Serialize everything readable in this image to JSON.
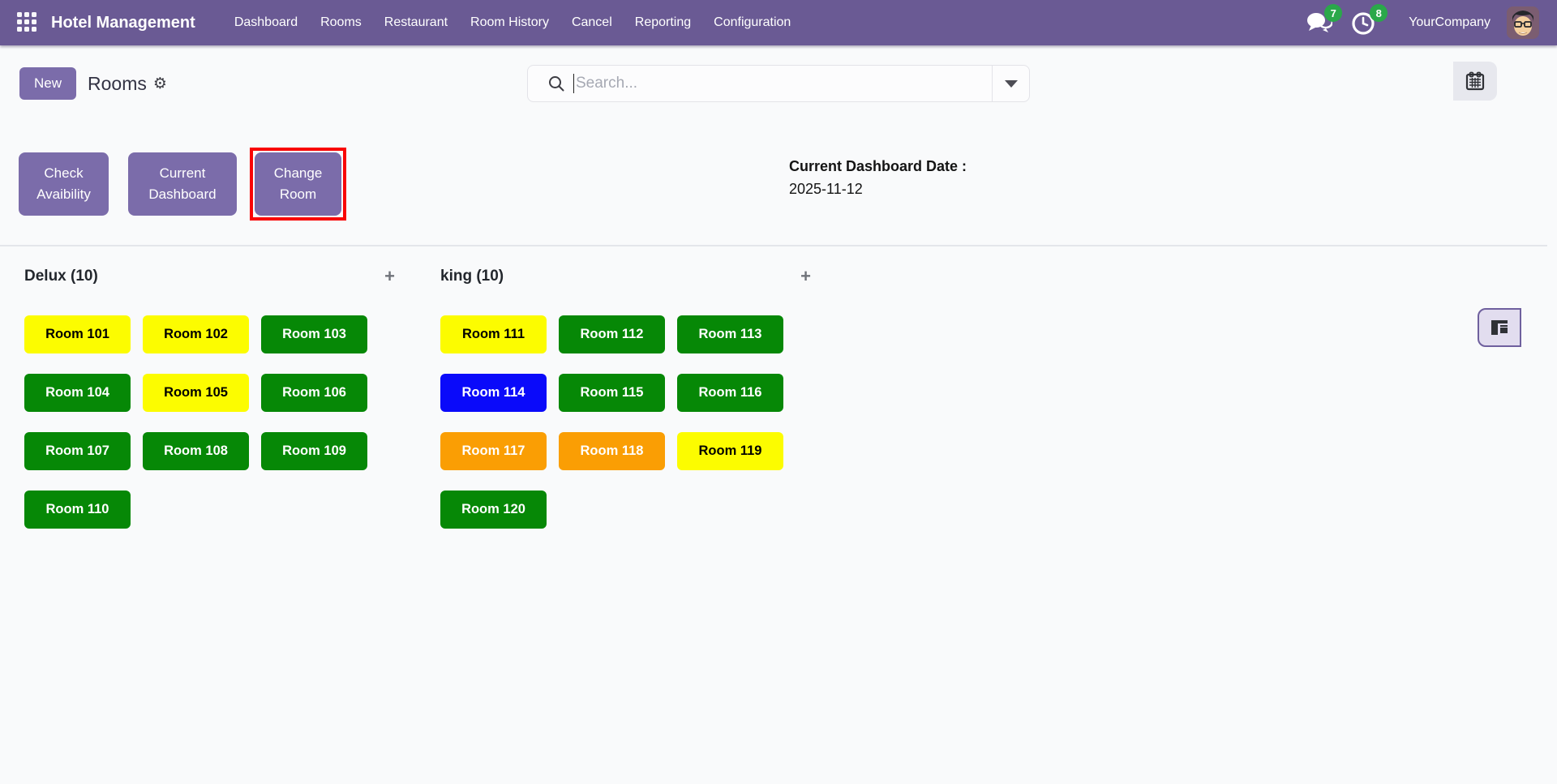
{
  "navbar": {
    "title": "Hotel Management",
    "menu_items": [
      "Dashboard",
      "Rooms",
      "Restaurant",
      "Room History",
      "Cancel",
      "Reporting",
      "Configuration"
    ],
    "messages_count": "7",
    "activities_count": "8",
    "company": "YourCompany"
  },
  "control_panel": {
    "new_button": "New",
    "breadcrumb": "Rooms",
    "gear_icon": "⚙",
    "search_placeholder": "Search..."
  },
  "actions": {
    "check_availability": "Check Avaibility",
    "current_dashboard": "Current Dashboard",
    "change_room": "Change Room",
    "date_label": "Current Dashboard Date :",
    "date_value": "2025-11-12"
  },
  "kanban": {
    "columns": [
      {
        "title": "Delux (10)",
        "add_label": "+",
        "rooms": [
          {
            "name": "Room 101",
            "color": "yellow"
          },
          {
            "name": "Room 102",
            "color": "yellow"
          },
          {
            "name": "Room 103",
            "color": "green"
          },
          {
            "name": "Room 104",
            "color": "green"
          },
          {
            "name": "Room 105",
            "color": "yellow"
          },
          {
            "name": "Room 106",
            "color": "green"
          },
          {
            "name": "Room 107",
            "color": "green"
          },
          {
            "name": "Room 108",
            "color": "green"
          },
          {
            "name": "Room 109",
            "color": "green"
          },
          {
            "name": "Room 110",
            "color": "green"
          }
        ]
      },
      {
        "title": "king (10)",
        "add_label": "+",
        "rooms": [
          {
            "name": "Room 111",
            "color": "yellow"
          },
          {
            "name": "Room 112",
            "color": "green"
          },
          {
            "name": "Room 113",
            "color": "green"
          },
          {
            "name": "Room 114",
            "color": "blue"
          },
          {
            "name": "Room 115",
            "color": "green"
          },
          {
            "name": "Room 116",
            "color": "green"
          },
          {
            "name": "Room 117",
            "color": "orange"
          },
          {
            "name": "Room 118",
            "color": "orange"
          },
          {
            "name": "Room 119",
            "color": "yellow"
          },
          {
            "name": "Room 120",
            "color": "green"
          }
        ]
      }
    ]
  },
  "colors": {
    "navbar_bg": "#6a5a94",
    "button_purple": "#7b6caa",
    "badge_green": "#2aa84a",
    "highlight_red": "#f90505",
    "room_yellow": "#fcfc00",
    "room_green": "#068806",
    "room_blue": "#0a0afa",
    "room_orange": "#fa9e04",
    "room_text_on_yellow": "#000000",
    "room_text_on_dark": "#ffffff"
  }
}
